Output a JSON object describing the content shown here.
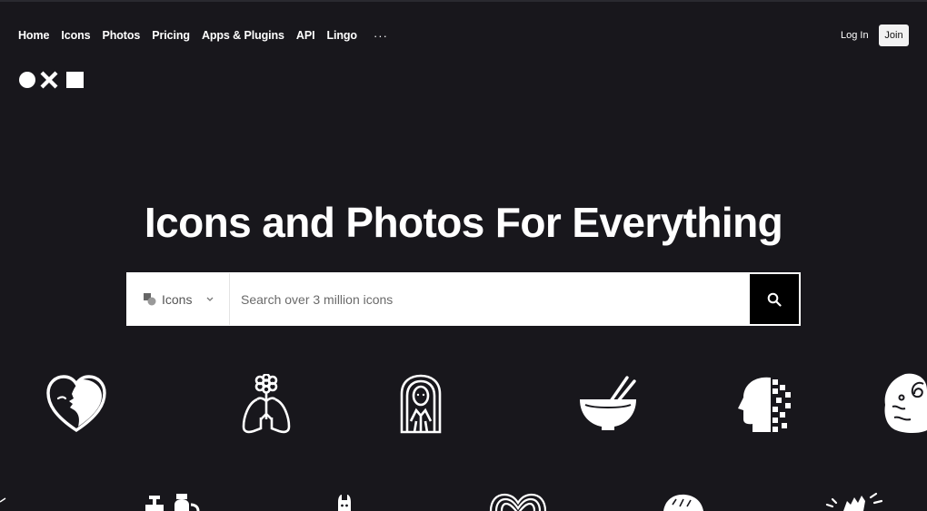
{
  "nav": {
    "items": [
      {
        "label": "Home"
      },
      {
        "label": "Icons"
      },
      {
        "label": "Photos"
      },
      {
        "label": "Pricing"
      },
      {
        "label": "Apps & Plugins"
      },
      {
        "label": "API"
      },
      {
        "label": "Lingo"
      }
    ],
    "more_label": "···",
    "login_label": "Log In",
    "join_label": "Join"
  },
  "hero": {
    "headline": "Icons and Photos For Everything"
  },
  "search": {
    "type_label": "Icons",
    "placeholder": "Search over 3 million icons"
  },
  "gallery": {
    "row1": [
      "heart-face-icon",
      "lungs-flower-icon",
      "woman-portrait-icon",
      "noodle-bowl-icon",
      "pixel-head-icon",
      "fossil-rock-icon"
    ],
    "row2": [
      "potion-bottles-icon",
      "bunny-icon",
      "rainbow-heart-icon",
      "pangolin-icon",
      "sparkle-hand-icon"
    ]
  },
  "colors": {
    "background": "#18171c",
    "search_button": "#000000",
    "text": "#ffffff"
  }
}
